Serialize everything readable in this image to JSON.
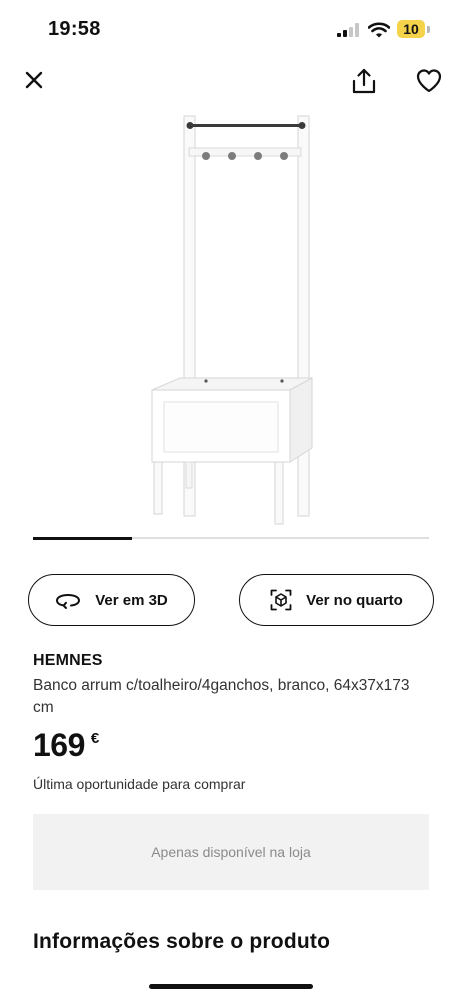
{
  "status_bar": {
    "time": "19:58",
    "battery_level": "10",
    "battery_color": "#f4d34a",
    "icons": [
      "signal-icon",
      "wifi-icon",
      "battery-icon"
    ]
  },
  "top_actions": {
    "icons": [
      "close-icon",
      "share-icon",
      "heart-icon"
    ]
  },
  "carousel": {
    "progress": 0.25
  },
  "actions": {
    "view_3d_label": "Ver em 3D",
    "view_3d_icon": "rotate-3d-icon",
    "view_room_label": "Ver no quarto",
    "view_room_icon": "ar-cube-icon"
  },
  "product": {
    "name": "HEMNES",
    "description": "Banco arrum c/toalheiro/4ganchos, branco, 64x37x173 cm",
    "price": "169",
    "currency": "€",
    "availability": "Última oportunidade para comprar",
    "store_notice": "Apenas disponível na loja"
  },
  "sections": {
    "product_info_title": "Informações sobre o produto"
  },
  "colors": {
    "text": "#111111",
    "muted": "#8a8a8a",
    "box_bg": "#f2f2f2"
  }
}
